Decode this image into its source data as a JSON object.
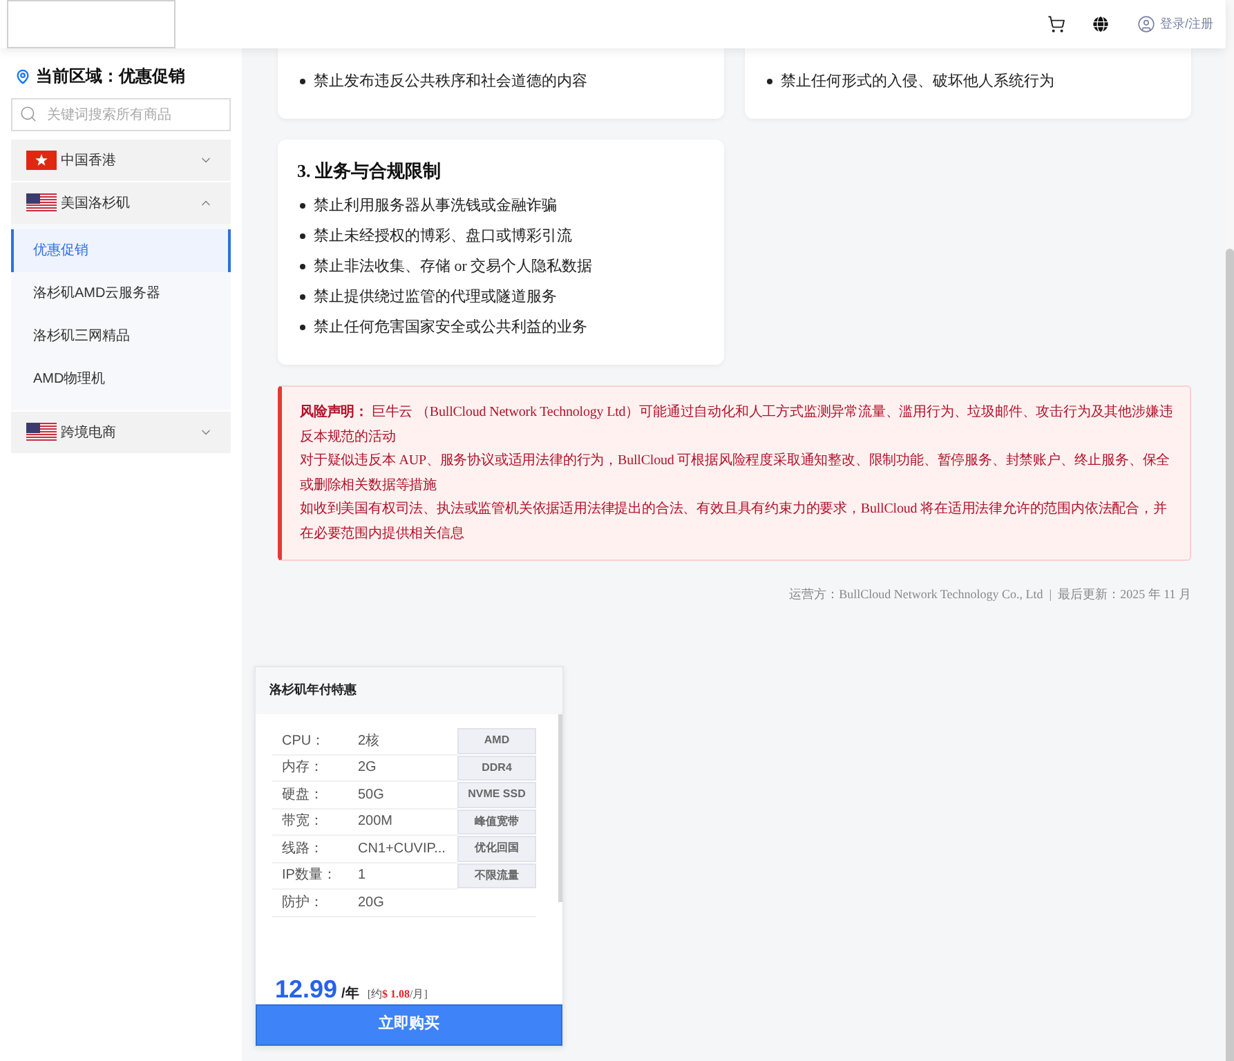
{
  "header": {
    "login_label": "登录/注册"
  },
  "sidebar": {
    "region_label": "当前区域：优惠促销",
    "search": {
      "placeholder": "关键词搜索所有商品"
    },
    "regions": [
      {
        "name": "中国香港",
        "kind": "hk",
        "expanded": false
      },
      {
        "name": "美国洛杉矶",
        "kind": "us",
        "expanded": true,
        "items": [
          {
            "label": "优惠促销",
            "selected": true
          },
          {
            "label": "洛杉矶AMD云服务器",
            "selected": false
          },
          {
            "label": "洛杉矶三网精品",
            "selected": false
          },
          {
            "label": "AMD物理机",
            "selected": false
          }
        ]
      },
      {
        "name": "跨境电商",
        "kind": "us",
        "expanded": false
      }
    ]
  },
  "rules": {
    "cards": [
      {
        "items": [
          "禁止发布违反公共秩序和社会道德的内容"
        ]
      },
      {
        "items": [
          "禁止任何形式的入侵、破坏他人系统行为"
        ]
      },
      {
        "title": "3. 业务与合规限制",
        "items": [
          "禁止利用服务器从事洗钱或金融诈骗",
          "禁止未经授权的博彩、盘口或博彩引流",
          "禁止非法收集、存储 or 交易个人隐私数据",
          "禁止提供绕过监管的代理或隧道服务",
          "禁止任何危害国家安全或公共利益的业务"
        ]
      }
    ]
  },
  "risk_notice": {
    "paragraphs": [
      "**风险声明：** 巨牛云 （BullCloud Network Technology Ltd）可能通过自动化和人工方式监测异常流量、滥用行为、垃圾邮件、攻击行为及其他涉嫌违反本规范的活动",
      "对于疑似违反本 AUP、服务协议或适用法律的行为，BullCloud 可根据风险程度采取通知整改、限制功能、暂停服务、封禁账户、终止服务、保全或删除相关数据等措施",
      "如收到美国有权司法、执法或监管机关依据适用法律提出的合法、有效且具有约束力的要求，BullCloud 将在适用法律允许的范围内依法配合，并在必要范围内提供相关信息"
    ]
  },
  "footer": {
    "text": "运营方：BullCloud Network Technology Co., Ltd  |  最后更新：2025 年 11 月"
  },
  "product": {
    "title": "洛杉矶年付特惠",
    "specs": [
      {
        "label": "CPU：",
        "value": "2核",
        "tag": "AMD"
      },
      {
        "label": "内存：",
        "value": "2G",
        "tag": "DDR4"
      },
      {
        "label": "硬盘：",
        "value": "50G",
        "tag": "NVME SSD"
      },
      {
        "label": "带宽：",
        "value": "200M",
        "tag": "峰值宽带"
      },
      {
        "label": "线路：",
        "value": "CN1+CUVIP...",
        "tag": "优化回国"
      },
      {
        "label": "IP数量：",
        "value": "1",
        "tag": "不限流量"
      },
      {
        "label": "防护：",
        "value": "20G"
      }
    ],
    "price": "12.99",
    "unit": "/年",
    "monthly_note": "[约**$ 1.08**/月]",
    "buy_label": "立即购买"
  }
}
